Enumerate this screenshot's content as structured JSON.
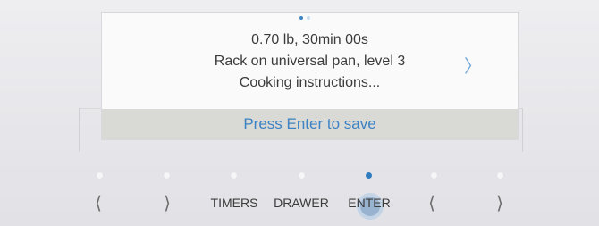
{
  "display": {
    "line1": "0.70 lb, 30min 00s",
    "line2": "Rack on universal pan, level 3",
    "line3": "Cooking instructions...",
    "next_icon": "chevron-right-icon",
    "save_bar": "Press Enter to save",
    "page_indicator": {
      "pages": 2,
      "current": 1
    }
  },
  "buttons": {
    "left_arrow_1": "⟨",
    "right_arrow_1": "⟩",
    "timers": "TIMERS",
    "drawer": "DRAWER",
    "enter": "ENTER",
    "left_arrow_2": "⟨",
    "right_arrow_2": "⟩"
  },
  "indicator_dots": {
    "count": 7,
    "active_index": 4
  },
  "colors": {
    "accent": "#3c82c4",
    "active_dot": "#2f7bc0",
    "save_bar_bg": "#d9d9d5"
  }
}
